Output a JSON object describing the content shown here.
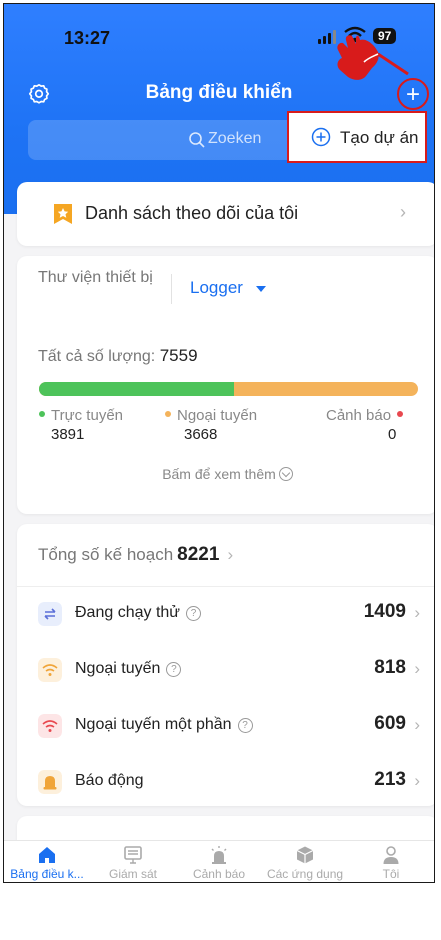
{
  "status_bar": {
    "time": "13:27",
    "battery": "97"
  },
  "header": {
    "title": "Bảng điều khiển"
  },
  "search": {
    "placeholder": "Zoeken"
  },
  "popup": {
    "create_project": "Tạo dự án"
  },
  "watchlist": {
    "label": "Danh sách theo dõi của tôi"
  },
  "library": {
    "label": "Thư viện thiết bị",
    "selected": "Logger",
    "total_label": "Tất cả số lượng:",
    "total_value": "7559",
    "online_label": "Trực tuyến",
    "online_value": "3891",
    "offline_label": "Ngoại tuyến",
    "offline_value": "3668",
    "alert_label": "Cảnh báo",
    "alert_value": "0",
    "online_fraction": 0.515,
    "more_label": "Bấm để xem thêm"
  },
  "plans": {
    "title": "Tổng số kế hoạch",
    "total": "8221",
    "items": [
      {
        "label": "Đang chạy thử",
        "value": "1409",
        "icon": "test-run-icon",
        "help": true
      },
      {
        "label": "Ngoại tuyến",
        "value": "818",
        "icon": "wifi-offline-icon",
        "help": true
      },
      {
        "label": "Ngoại tuyến một phần",
        "value": "609",
        "icon": "wifi-partial-icon",
        "help": true
      },
      {
        "label": "Báo động",
        "value": "213",
        "icon": "alarm-icon",
        "help": false
      }
    ]
  },
  "tabs": [
    {
      "label": "Bảng điều k...",
      "icon": "home-icon",
      "active": true
    },
    {
      "label": "Giám sát",
      "icon": "monitor-icon",
      "active": false
    },
    {
      "label": "Cảnh báo",
      "icon": "alarm-light-icon",
      "active": false
    },
    {
      "label": "Các ứng dụng",
      "icon": "apps-cube-icon",
      "active": false
    },
    {
      "label": "Tôi",
      "icon": "user-icon",
      "active": false
    }
  ],
  "colors": {
    "brand_blue": "#1a6ff0",
    "online_green": "#4dc35a",
    "offline_orange": "#f4b35b",
    "alert_red": "#e8484f",
    "annotation_red": "#d81b1b"
  }
}
